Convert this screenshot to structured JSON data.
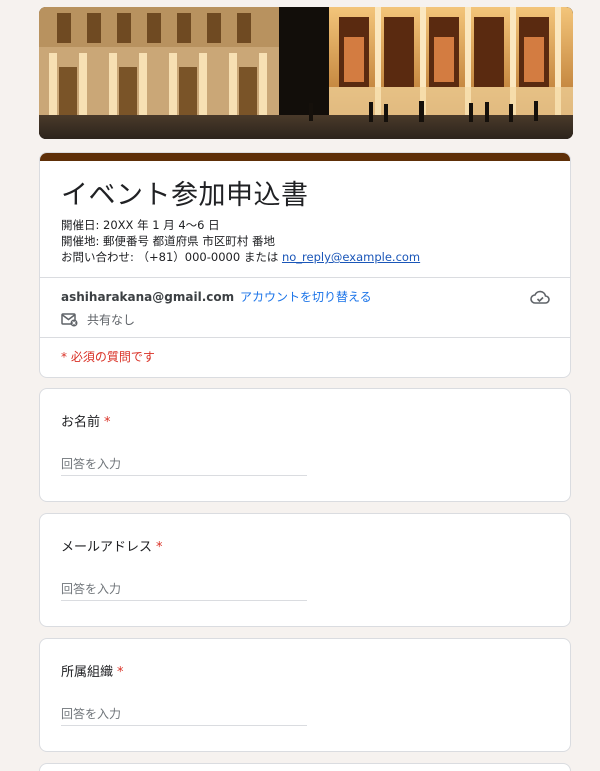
{
  "banner": {
    "image": "concert-hall-night-photo"
  },
  "form": {
    "title": "イベント参加申込書",
    "description_lines": [
      "開催日: 20XX 年 1 月 4〜6 日",
      "開催地: 郵便番号 都道府県 市区町村 番地"
    ],
    "contact_prefix": "お問い合わせ: （+81）000-0000 または ",
    "contact_email": "no_reply@example.com",
    "account_email": "ashiharakana@gmail.com",
    "switch_account": "アカウントを切り替える",
    "not_shared": "共有なし",
    "required_note": "* 必須の質問です"
  },
  "questions": [
    {
      "label": "お名前",
      "required": "*",
      "placeholder": "回答を入力"
    },
    {
      "label": "メールアドレス",
      "required": "*",
      "placeholder": "回答を入力"
    },
    {
      "label": "所属組織",
      "required": "*",
      "placeholder": "回答を入力"
    }
  ],
  "colors": {
    "theme_bar": "#5e2f08",
    "background": "#f6f2ef",
    "link": "#1a73e8",
    "required": "#d93025"
  },
  "icons": [
    "cloud-check-icon",
    "mail-off-icon"
  ]
}
